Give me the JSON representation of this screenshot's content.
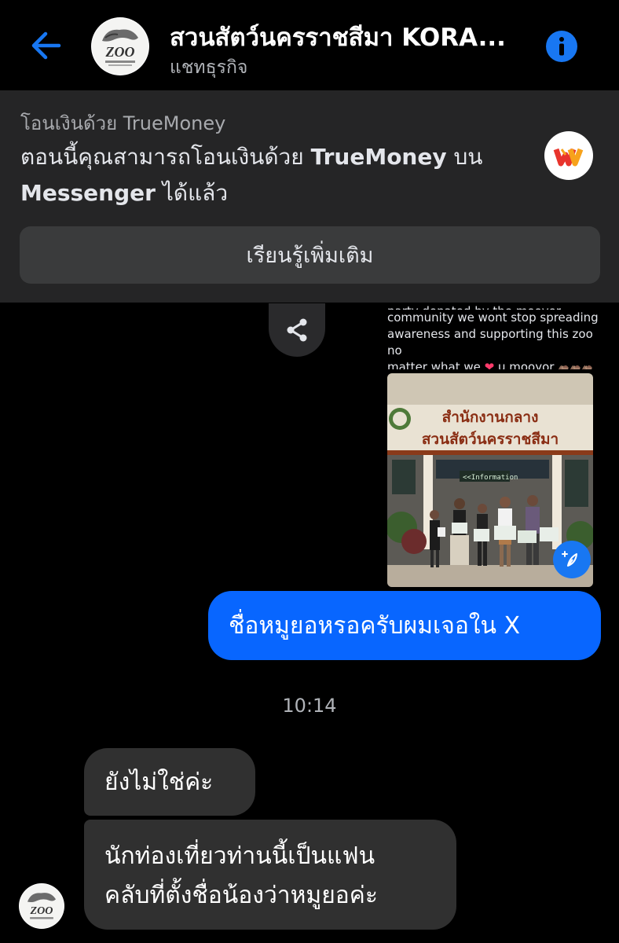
{
  "header": {
    "title": "สวนสัตว์นครราชสีมา KORA...",
    "subtitle": "แชทธุรกิจ",
    "avatar_logo_text": "ZOO",
    "back_icon": "arrow-left-icon",
    "info_icon": "info-icon"
  },
  "banner": {
    "title": "โอนเงินด้วย TrueMoney",
    "text_part1": "ตอนนี้คุณสามารถโอนเงินด้วย ",
    "text_brand": "TrueMoney",
    "text_part2": " บน",
    "text_brand2": "Messenger",
    "text_part3": " ได้แล้ว",
    "learn_more_label": "เรียนรู้เพิ่มเติม",
    "logo_icon": "truemoney-logo-icon"
  },
  "shared_post": {
    "caption_line1": "party donated by the mooyor",
    "caption_line2": "community we wont stop spreading",
    "caption_line3": "awareness and supporting this zoo no",
    "caption_line4a": "matter what we ",
    "caption_line4b": " u mooyor ",
    "caption_emoji_heart": "❤",
    "caption_emoji_hippos": "🦛🦛🦛🦛",
    "caption_emoji_hippos2": "🦛🦛",
    "photo_sign_line1": "สำนักงานกลาง",
    "photo_sign_line2": "สวนสัตว์นครราชสีมา",
    "photo_info_label": "<<Information",
    "share_icon": "share-icon",
    "sparkle_icon": "sparkle-icon"
  },
  "messages": {
    "outgoing_1": "ชื่อหมูยอหรอครับผมเจอใน X",
    "timestamp": "10:14",
    "incoming_1": "ยังไม่ใช่ค่ะ",
    "incoming_2_line1": "นักท่องเที่ยวท่านนี้เป็นแฟน",
    "incoming_2_line2": "คลับที่ตั้งชื่อน้องว่าหมูยอค่ะ"
  },
  "colors": {
    "accent_blue": "#0866ff",
    "incoming_bubble": "#303030",
    "banner_bg": "#252526",
    "button_bg": "#3a3b3c",
    "secondary_text": "#b0b3b8"
  }
}
